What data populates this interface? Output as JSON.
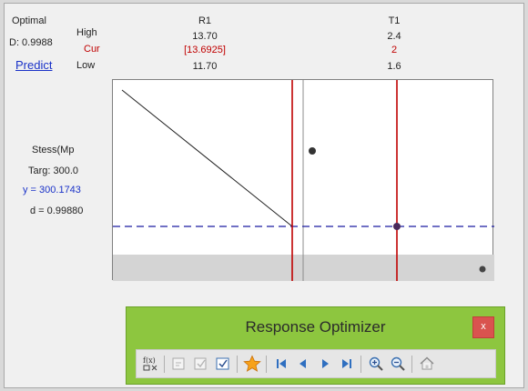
{
  "panel": {
    "optimal_label": "Optimal",
    "d_label": "D: 0.9988",
    "predict_link": "Predict",
    "row_high": "High",
    "row_cur": "Cur",
    "row_low": "Low"
  },
  "factors": [
    {
      "name": "R1",
      "high": "13.70",
      "cur": "[13.6925]",
      "low": "11.70"
    },
    {
      "name": "T1",
      "high": "2.4",
      "cur": "2",
      "low": "1.6"
    }
  ],
  "response": {
    "name": "Stess(Mp",
    "target": "Targ: 300.0",
    "y": "y = 300.1743",
    "d": "d = 0.99880"
  },
  "toolbar": {
    "title": "Response Optimizer",
    "close": "x",
    "buttons": [
      "edit-setup-icon",
      "first-disabled-icon",
      "copy-disabled-icon",
      "checklist-icon",
      "star-icon",
      "first-solution-icon",
      "previous-icon",
      "next-icon",
      "last-solution-icon",
      "zoom-in-icon",
      "zoom-out-icon",
      "home-icon"
    ]
  },
  "colors": {
    "current_line": "#c00000",
    "target_line": "#1a1aa0",
    "cur_text": "#c00000",
    "y_text": "#1a32c8",
    "toolbar_bg": "#8dc63f",
    "close_bg": "#d9534f"
  }
}
